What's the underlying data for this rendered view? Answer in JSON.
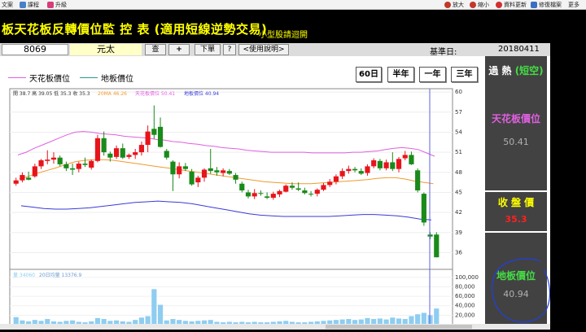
{
  "toolbar": {
    "file": "文案",
    "course": "課程",
    "upgrade": "升級",
    "zoom_in": "放大",
    "zoom_out": "縮小",
    "refresh": "資料更新",
    "edit": "修復檔案",
    "more": "更多"
  },
  "header": {
    "title": "板天花板反轉價位監 控 表 (適用短線逆勢交易)",
    "subtitle": "小型股請迴開"
  },
  "stock": {
    "code": "8069",
    "name": "元太",
    "btn_check": "查",
    "btn_plus": "+",
    "btn_order": "下單",
    "btn_help": "?",
    "btn_manual": "<使用說明>",
    "base_label": "基準日:",
    "base_date": "20180411"
  },
  "legend": {
    "ceiling": "天花板價位",
    "floor": "地板價位"
  },
  "periods": [
    "60日",
    "半年",
    "一年",
    "三年"
  ],
  "chart_info": {
    "ohlc": "開 38.7 高 39.05 低 35.3 收 35.3",
    "ma": "20MA 46.26",
    "ceiling": "天花板價位 50.41",
    "floor": "地板價位 40.94",
    "volume": "量 34060",
    "avg_volume": "20日均量 13376.9"
  },
  "side": {
    "status": "過 熱",
    "status_sub": "(短空)",
    "ceiling_label": "天花板價位",
    "ceiling_value": "50.41",
    "close_label": "收 盤 價",
    "close_value": "35.3",
    "floor_label": "地板價位",
    "floor_value": "40.94"
  },
  "colors": {
    "up": "#e8141b",
    "down": "#1a8a1a",
    "ceiling": "#e060e0",
    "floor": "#3a3ad8",
    "ma": "#f09a30",
    "volume": "#8ecdf0"
  },
  "chart_data": {
    "type": "candlestick",
    "ylim": [
      33.5,
      60.5
    ],
    "yticks": [
      36,
      39,
      42,
      45,
      48,
      51,
      54,
      57,
      60
    ],
    "volume_ticks": [
      "100,000",
      "80,000",
      "60,000",
      "40,000",
      "20,000"
    ],
    "volume_max": 110000,
    "candles": [
      [
        46.3,
        47.2,
        46.0,
        46.8
      ],
      [
        46.8,
        48.0,
        46.5,
        47.6
      ],
      [
        47.2,
        48.1,
        46.8,
        46.9
      ],
      [
        47.4,
        49.3,
        47.2,
        48.9
      ],
      [
        48.9,
        50.0,
        48.5,
        49.8
      ],
      [
        49.7,
        51.3,
        49.2,
        49.9
      ],
      [
        49.9,
        51.0,
        49.3,
        50.2
      ],
      [
        50.2,
        50.5,
        48.9,
        49.2
      ],
      [
        49.2,
        49.6,
        48.2,
        48.6
      ],
      [
        48.6,
        49.3,
        47.6,
        48.4
      ],
      [
        48.5,
        49.6,
        48.0,
        49.3
      ],
      [
        49.3,
        50.2,
        48.8,
        49.1
      ],
      [
        48.7,
        49.9,
        48.4,
        49.7
      ],
      [
        49.7,
        53.6,
        49.5,
        53.1
      ],
      [
        53.1,
        54.1,
        50.5,
        51.0
      ],
      [
        50.8,
        51.1,
        49.6,
        50.2
      ],
      [
        50.3,
        52.0,
        50.0,
        51.6
      ],
      [
        51.6,
        52.3,
        50.0,
        50.2
      ],
      [
        50.3,
        50.8,
        50.0,
        50.6
      ],
      [
        50.6,
        51.5,
        50.0,
        51.0
      ],
      [
        51.0,
        52.6,
        50.5,
        52.1
      ],
      [
        52.1,
        55.0,
        51.0,
        54.1
      ],
      [
        54.5,
        58.0,
        53.0,
        53.6
      ],
      [
        54.8,
        56.2,
        51.7,
        51.8
      ],
      [
        51.2,
        51.5,
        49.9,
        50.2
      ],
      [
        49.6,
        49.8,
        45.2,
        47.7
      ],
      [
        47.7,
        49.5,
        47.1,
        48.9
      ],
      [
        48.9,
        49.4,
        48.2,
        48.5
      ],
      [
        48.1,
        48.5,
        46.0,
        46.2
      ],
      [
        46.5,
        47.5,
        45.8,
        47.2
      ],
      [
        47.2,
        48.6,
        46.6,
        48.4
      ],
      [
        48.6,
        51.5,
        47.8,
        48.2
      ],
      [
        48.3,
        48.8,
        47.5,
        48.0
      ],
      [
        47.9,
        48.6,
        47.4,
        48.3
      ],
      [
        48.2,
        48.5,
        47.6,
        47.8
      ],
      [
        47.6,
        47.9,
        46.3,
        46.9
      ],
      [
        46.3,
        46.6,
        45.0,
        45.3
      ],
      [
        45.0,
        45.4,
        44.1,
        44.4
      ],
      [
        44.4,
        45.5,
        44.0,
        44.9
      ],
      [
        44.9,
        45.3,
        44.5,
        44.8
      ],
      [
        44.4,
        45.0,
        44.0,
        44.2
      ],
      [
        44.2,
        45.1,
        43.9,
        44.8
      ],
      [
        44.7,
        45.4,
        44.3,
        45.2
      ],
      [
        45.1,
        46.2,
        45.0,
        46.0
      ],
      [
        46.0,
        46.5,
        45.4,
        45.7
      ],
      [
        45.6,
        46.5,
        45.2,
        45.4
      ],
      [
        45.3,
        45.7,
        44.7,
        44.9
      ],
      [
        44.8,
        45.2,
        44.4,
        44.7
      ],
      [
        44.8,
        45.6,
        44.4,
        45.4
      ],
      [
        45.4,
        46.4,
        45.2,
        46.1
      ],
      [
        46.1,
        47.0,
        45.8,
        46.6
      ],
      [
        46.6,
        47.7,
        46.2,
        47.4
      ],
      [
        47.4,
        48.6,
        47.0,
        48.2
      ],
      [
        48.2,
        49.0,
        47.8,
        48.5
      ],
      [
        48.5,
        48.8,
        48.0,
        48.3
      ],
      [
        48.2,
        48.6,
        47.6,
        47.8
      ],
      [
        47.9,
        49.2,
        47.5,
        48.9
      ],
      [
        48.9,
        50.1,
        48.6,
        49.8
      ],
      [
        49.7,
        50.0,
        48.3,
        48.6
      ],
      [
        48.6,
        49.9,
        48.3,
        49.5
      ],
      [
        49.5,
        51.0,
        48.2,
        48.5
      ],
      [
        48.5,
        50.3,
        48.0,
        50.0
      ],
      [
        50.1,
        51.2,
        49.8,
        50.6
      ],
      [
        50.6,
        51.1,
        49.1,
        49.2
      ],
      [
        48.3,
        48.6,
        45.0,
        45.3
      ],
      [
        44.8,
        45.0,
        40.0,
        40.5
      ],
      [
        38.7,
        39.05,
        38.0,
        38.4
      ],
      [
        38.7,
        39.05,
        35.3,
        35.3
      ]
    ],
    "ceiling_line": [
      50.6,
      51.0,
      51.6,
      52.1,
      52.6,
      53.1,
      53.6,
      54.0,
      54.1,
      54.0,
      53.8,
      53.7,
      53.6,
      53.4,
      53.3,
      53.2,
      53.1,
      52.9,
      52.8,
      52.6,
      52.5,
      52.3,
      52.2,
      52.0,
      51.9,
      51.7,
      51.6,
      51.5,
      51.3,
      51.2,
      51.1,
      51.0,
      51.0,
      51.0,
      51.0,
      51.0,
      50.9,
      50.9,
      50.9,
      50.9,
      50.9,
      51.0,
      51.0,
      51.1,
      51.2,
      51.4,
      51.6,
      51.7,
      51.6,
      51.4,
      50.9,
      50.4
    ],
    "floor_line": [
      43.0,
      42.8,
      42.6,
      42.5,
      42.5,
      42.6,
      42.7,
      42.9,
      43.1,
      43.3,
      43.5,
      43.6,
      43.7,
      43.6,
      43.5,
      43.3,
      43.0,
      42.7,
      42.4,
      42.1,
      41.8,
      41.6,
      41.5,
      41.4,
      41.4,
      41.4,
      41.4,
      41.4,
      41.5,
      41.6,
      41.7,
      41.7,
      41.6,
      41.5,
      41.3,
      41.0,
      40.9
    ],
    "ma_line": [
      47.0,
      47.4,
      47.9,
      48.3,
      48.7,
      49.2,
      49.6,
      49.8,
      49.9,
      49.9,
      49.8,
      49.6,
      49.4,
      49.2,
      49.0,
      48.8,
      48.6,
      48.4,
      48.2,
      48.0,
      47.8,
      47.6,
      47.4,
      47.2,
      47.0,
      46.8,
      46.6,
      46.5,
      46.4,
      46.3,
      46.3,
      46.3,
      46.4,
      46.5,
      46.6,
      46.7,
      46.8,
      46.9,
      47.1,
      47.2,
      47.2,
      47.0,
      46.7,
      46.5,
      46.3
    ],
    "volumes": [
      16000,
      9000,
      7000,
      10000,
      8000,
      12000,
      7000,
      6000,
      8000,
      9000,
      6000,
      5000,
      7000,
      14000,
      12000,
      8000,
      9000,
      7000,
      6000,
      10000,
      15000,
      18000,
      75000,
      42000,
      9000,
      12000,
      10000,
      8000,
      7000,
      8000,
      9000,
      10000,
      6000,
      5000,
      6000,
      5000,
      6000,
      5000,
      6000,
      5000,
      5000,
      6000,
      7000,
      8000,
      6000,
      5000,
      5000,
      6000,
      7000,
      8000,
      9000,
      10000,
      11000,
      12000,
      10000,
      11000,
      14000,
      12000,
      13000,
      11000,
      15000,
      13000,
      12000,
      18000,
      22000,
      25000,
      20000,
      34060
    ]
  }
}
